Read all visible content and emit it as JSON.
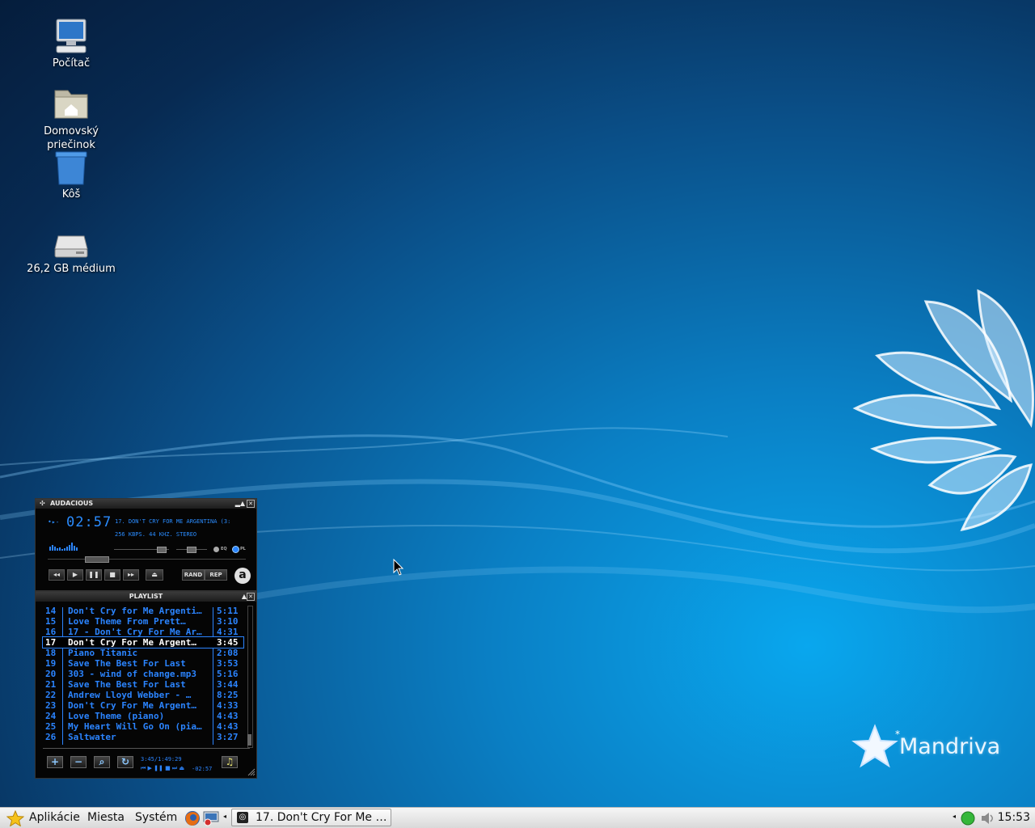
{
  "desktop": {
    "icons": [
      {
        "label": "Počítač"
      },
      {
        "label": "Domovský priečinok"
      },
      {
        "label": "Kôš"
      },
      {
        "label": "26,2 GB médium"
      }
    ],
    "brand": "Mandriva"
  },
  "audacious": {
    "title": "AUDACIOUS",
    "time": "02:57",
    "song_title": "17. DON'T CRY FOR ME ARGENTINA (3:",
    "stream_info": "256 KBPS. 44 KHZ. STEREO",
    "eq_label": "EQ",
    "pl_label": "PL",
    "rand_label": "RAND",
    "rep_label": "REP",
    "logo_letter": "a"
  },
  "playlist": {
    "title": "PLAYLIST",
    "rows": [
      {
        "num": "14",
        "title": "Don't Cry for Me Argenti…",
        "dur": "5:11"
      },
      {
        "num": "15",
        "title": "Love Theme From Prett…",
        "dur": "3:10"
      },
      {
        "num": "16",
        "title": "17 - Don't Cry For Me Ar…",
        "dur": "4:31"
      },
      {
        "num": "17",
        "title": "Don't Cry For Me Argent…",
        "dur": "3:45",
        "selected": true
      },
      {
        "num": "18",
        "title": "Piano Titanic",
        "dur": "2:08"
      },
      {
        "num": "19",
        "title": "Save The Best For Last",
        "dur": "3:53"
      },
      {
        "num": "20",
        "title": "303 - wind of change.mp3",
        "dur": "5:16"
      },
      {
        "num": "21",
        "title": "Save The Best For Last",
        "dur": "3:44"
      },
      {
        "num": "22",
        "title": "Andrew Lloyd Webber - …",
        "dur": "8:25"
      },
      {
        "num": "23",
        "title": "Don't Cry For Me Argent…",
        "dur": "4:33"
      },
      {
        "num": "24",
        "title": "Love Theme (piano)",
        "dur": "4:43"
      },
      {
        "num": "25",
        "title": "My Heart Will Go On (pia…",
        "dur": "4:43"
      },
      {
        "num": "26",
        "title": "Saltwater",
        "dur": "3:27"
      }
    ],
    "total_time": "3:45/1:49:29",
    "remaining": "-02:57"
  },
  "panel": {
    "menu_apps": "Aplikácie",
    "menu_places": "Miesta",
    "menu_system": "Systém",
    "task_label": "17. Don't Cry For Me …",
    "clock": "15:53"
  },
  "colors": {
    "lcd": "#2b84ff",
    "panel_bg": "#e8e8e8",
    "desktop_blue": "#0a7fc4"
  }
}
